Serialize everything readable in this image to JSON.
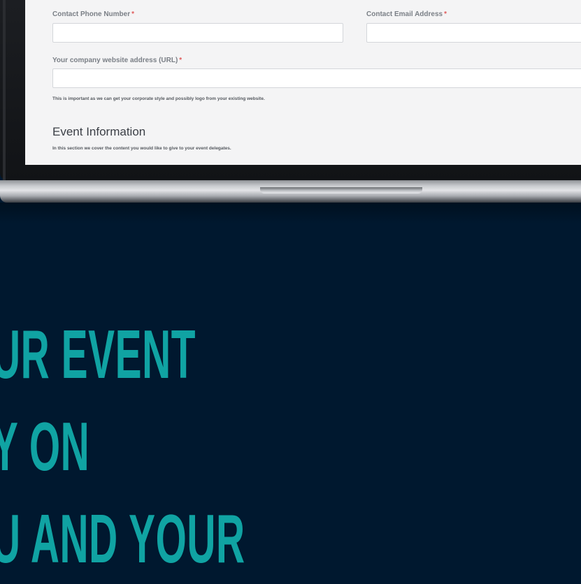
{
  "form": {
    "phone_label": "Contact Phone Number",
    "email_label": "Contact Email Address",
    "required_mark": "*",
    "website_label": "Your company website address (URL)",
    "website_hint": "This is important as we can get your corporate style and possibly logo from your existing website.",
    "phone_value": "",
    "email_value": "",
    "website_value": ""
  },
  "section": {
    "title": "Event Information",
    "description": "In this section we cover the content you would like to give to your event delegates."
  },
  "headline": {
    "line1": "UR EVENT",
    "line2": "Y ON",
    "line3": "U AND YOUR"
  },
  "colors": {
    "background": "#00182f",
    "headline": "#10a3a3",
    "required": "#e05a5a"
  }
}
